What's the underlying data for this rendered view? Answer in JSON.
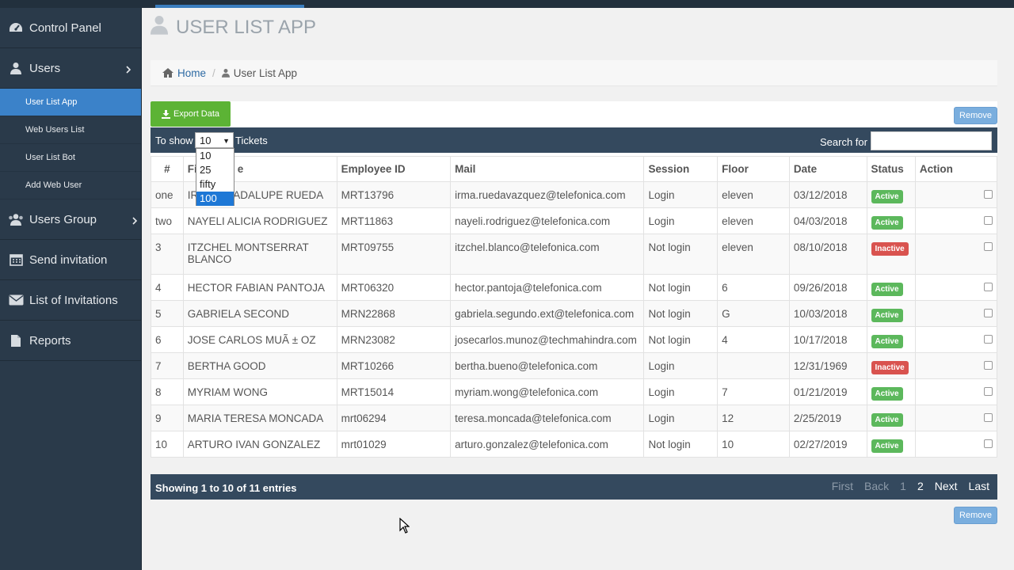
{
  "colors": {
    "accent": "#3b82c9",
    "sidebar": "#2a3a4a",
    "toolbar": "#34495e",
    "export": "#5cb335",
    "active": "#5cb85c",
    "inactive": "#d9534f"
  },
  "sidebar": {
    "control_panel": "Control Panel",
    "users": "Users",
    "submenu": [
      "User List App",
      "Web Users List",
      "User List Bot",
      "Add Web User"
    ],
    "users_group": "Users Group",
    "send_invitation": "Send invitation",
    "list_invitations": "List of Invitations",
    "reports": "Reports"
  },
  "page": {
    "title": "USER LIST APP"
  },
  "breadcrumb": {
    "home": "Home",
    "current": "User List App",
    "separator": "/"
  },
  "toolbar": {
    "export_label": "Export Data",
    "remove_label": "Remove",
    "show_label": "To show",
    "selected": "10",
    "tickets_label": "Tickets",
    "search_label": "Search for",
    "search_value": "",
    "options": [
      "10",
      "25",
      "fifty",
      "100"
    ],
    "highlighted_option": "100"
  },
  "table": {
    "headers": [
      "#",
      "Fi",
      "e",
      "Employee ID",
      "Mail",
      "Session",
      "Floor",
      "Date",
      "Status",
      "Action"
    ],
    "rows": [
      {
        "num": "one",
        "name": "IR",
        "name_rest": "ADALUPE RUEDA",
        "emp": "MRT13796",
        "mail": "irma.ruedavazquez@telefonica.com",
        "session": "Login",
        "floor": "eleven",
        "date": "03/12/2018",
        "status": "Active"
      },
      {
        "num": "two",
        "name": "NAYELI ALICIA RODRIGUEZ",
        "emp": "MRT11863",
        "mail": "nayeli.rodriguez@telefonica.com",
        "session": "Login",
        "floor": "eleven",
        "date": "04/03/2018",
        "status": "Active"
      },
      {
        "num": "3",
        "name": "ITZCHEL MONTSERRAT BLANCO",
        "emp": "MRT09755",
        "mail": "itzchel.blanco@telefonica.com",
        "session": "Not login",
        "floor": "eleven",
        "date": "08/10/2018",
        "status": "Inactive"
      },
      {
        "num": "4",
        "name": "HECTOR FABIAN PANTOJA",
        "emp": "MRT06320",
        "mail": "hector.pantoja@telefonica.com",
        "session": "Not login",
        "floor": "6",
        "date": "09/26/2018",
        "status": "Active"
      },
      {
        "num": "5",
        "name": "GABRIELA SECOND",
        "emp": "MRN22868",
        "mail": "gabriela.segundo.ext@telefonica.com",
        "session": "Not login",
        "floor": "G",
        "date": "10/03/2018",
        "status": "Active"
      },
      {
        "num": "6",
        "name": "JOSE CARLOS MUÃ ± OZ",
        "emp": "MRN23082",
        "mail": "josecarlos.munoz@techmahindra.com",
        "session": "Not login",
        "floor": "4",
        "date": "10/17/2018",
        "status": "Active"
      },
      {
        "num": "7",
        "name": "BERTHA GOOD",
        "emp": "MRT10266",
        "mail": "bertha.bueno@telefonica.com",
        "session": "Login",
        "floor": "",
        "date": "12/31/1969",
        "status": "Inactive"
      },
      {
        "num": "8",
        "name": "MYRIAM WONG",
        "emp": "MRT15014",
        "mail": "myriam.wong@telefonica.com",
        "session": "Login",
        "floor": "7",
        "date": "01/21/2019",
        "status": "Active"
      },
      {
        "num": "9",
        "name": "MARIA TERESA MONCADA",
        "emp": "mrt06294",
        "mail": "teresa.moncada@telefonica.com",
        "session": "Login",
        "floor": "12",
        "date": "2/25/2019",
        "status": "Active"
      },
      {
        "num": "10",
        "name": "ARTURO IVAN GONZALEZ",
        "emp": "mrt01029",
        "mail": "arturo.gonzalez@telefonica.com",
        "session": "Not login",
        "floor": "10",
        "date": "02/27/2019",
        "status": "Active"
      }
    ]
  },
  "footer": {
    "info": "Showing 1 to 10 of 11 entries",
    "pager": {
      "first": "First",
      "back": "Back",
      "p1": "1",
      "p2": "2",
      "next": "Next",
      "last": "Last"
    }
  },
  "icons": [
    "dashboard-icon",
    "user-icon",
    "users-icon",
    "calendar-icon",
    "envelope-icon",
    "file-icon",
    "home-icon",
    "download-icon",
    "chevron-right-icon",
    "cursor-icon"
  ]
}
